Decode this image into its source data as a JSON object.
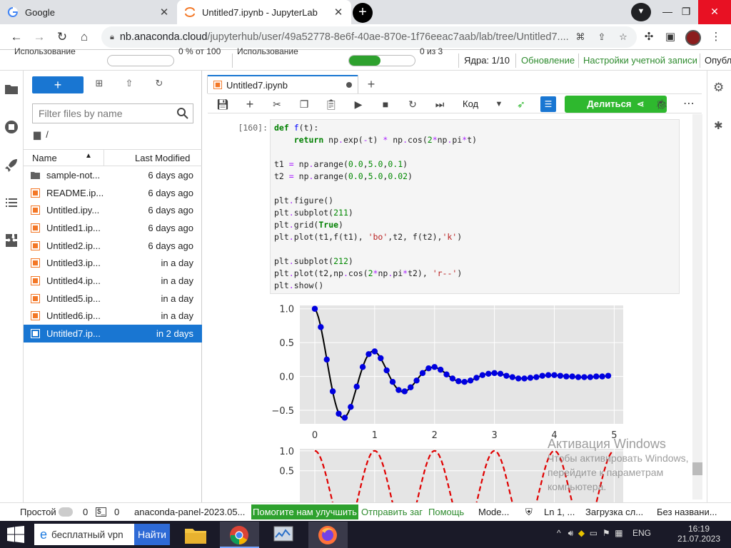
{
  "browser": {
    "tabs": [
      {
        "title": "Google",
        "active": false
      },
      {
        "title": "Untitled7.ipynb - JupyterLab",
        "active": true
      }
    ],
    "url_host": "nb.anaconda.cloud",
    "url_path": "/jupyterhub/user/49a52778-8e6f-40ae-870e-1f76eeac7aab/lab/tree/Untitled7...."
  },
  "jupyter_top": {
    "usage_label_1": "Использование",
    "usage_value_1": "0 % от 100",
    "usage_label_2": "Использование",
    "usage_value_2": "0 из 3",
    "cores": "Ядра: 1/10",
    "update": "Обновление",
    "account_settings": "Настройки учетной записи",
    "publish": "Опубл",
    "bar2_fill": 0.48
  },
  "filebrowser": {
    "new_label": "+",
    "filter_placeholder": "Filter files by name",
    "breadcrumb": "/",
    "col_name": "Name",
    "col_modified": "Last Modified",
    "files": [
      {
        "name": "sample-not...",
        "modified": "6 days ago",
        "type": "folder"
      },
      {
        "name": "README.ip...",
        "modified": "6 days ago",
        "type": "notebook"
      },
      {
        "name": "Untitled.ipy...",
        "modified": "6 days ago",
        "type": "notebook"
      },
      {
        "name": "Untitled1.ip...",
        "modified": "6 days ago",
        "type": "notebook"
      },
      {
        "name": "Untitled2.ip...",
        "modified": "6 days ago",
        "type": "notebook"
      },
      {
        "name": "Untitled3.ip...",
        "modified": "in a day",
        "type": "notebook"
      },
      {
        "name": "Untitled4.ip...",
        "modified": "in a day",
        "type": "notebook"
      },
      {
        "name": "Untitled5.ip...",
        "modified": "in a day",
        "type": "notebook"
      },
      {
        "name": "Untitled6.ip...",
        "modified": "in a day",
        "type": "notebook"
      },
      {
        "name": "Untitled7.ip...",
        "modified": "in 2 days",
        "type": "notebook",
        "selected": true
      }
    ]
  },
  "notebook": {
    "tab_title": "Untitled7.ipynb",
    "kernel_mode": "Код",
    "share_label": "Делиться",
    "prompt": "[160]:"
  },
  "chart_data": [
    {
      "type": "line",
      "x": [
        0.0,
        0.1,
        0.2,
        0.3,
        0.4,
        0.5,
        0.6,
        0.7,
        0.8,
        0.9,
        1.0,
        1.1,
        1.2,
        1.3,
        1.4,
        1.5,
        1.6,
        1.7,
        1.8,
        1.9,
        2.0,
        2.1,
        2.2,
        2.3,
        2.4,
        2.5,
        2.6,
        2.7,
        2.8,
        2.9,
        3.0,
        3.1,
        3.2,
        3.3,
        3.4,
        3.5,
        3.6,
        3.7,
        3.8,
        3.9,
        4.0,
        4.1,
        4.2,
        4.3,
        4.4,
        4.5,
        4.6,
        4.7,
        4.8,
        4.9
      ],
      "series": [
        {
          "values": [
            1.0,
            0.73,
            0.25,
            -0.22,
            -0.55,
            -0.61,
            -0.45,
            -0.15,
            0.14,
            0.33,
            0.37,
            0.27,
            0.09,
            -0.08,
            -0.2,
            -0.22,
            -0.16,
            -0.06,
            0.05,
            0.12,
            0.14,
            0.1,
            0.03,
            -0.03,
            -0.07,
            -0.08,
            -0.06,
            -0.02,
            0.02,
            0.04,
            0.05,
            0.04,
            0.01,
            -0.01,
            -0.03,
            -0.03,
            -0.02,
            -0.01,
            0.01,
            0.02,
            0.02,
            0.01,
            0.0,
            0.0,
            -0.01,
            -0.01,
            -0.01,
            0.0,
            0.0,
            0.01
          ]
        }
      ],
      "xlim": [
        -0.25,
        5.15
      ],
      "ylim": [
        -0.7,
        1.05
      ],
      "xticks": [
        "0",
        "1",
        "2",
        "3",
        "4",
        "5"
      ],
      "yticks": [
        "1.0",
        "0.5",
        "0.0",
        "−0.5"
      ],
      "grid": true
    },
    {
      "type": "line",
      "x_range": [
        0,
        4.98
      ],
      "series": [
        {
          "color": "#e00000",
          "style": "dashed"
        }
      ],
      "xlim": [
        -0.25,
        5.15
      ],
      "ylim": [
        -1.1,
        1.05
      ],
      "yticks": [
        "1.0",
        "0.5"
      ],
      "grid": true
    }
  ],
  "watermark": {
    "line1": "Активация Windows",
    "line2": "Чтобы активировать Windows,",
    "line3": "перейдите к параметрам",
    "line4": "компьютера."
  },
  "statusbar": {
    "mode": "Простой",
    "n1": "0",
    "n2": "0",
    "panel": "anaconda-panel-2023.05...",
    "help": "Помогите нам улучшить",
    "send": "Отправить заг",
    "help2": "Помощь",
    "mode2": "Mode...",
    "ln": "Ln 1, ...",
    "loading": "Загрузка сл...",
    "untitled": "Без названи..."
  },
  "taskbar": {
    "search_text": "бесплатный vpn",
    "find_label": "Найти",
    "lang": "ENG",
    "time": "16:19",
    "date": "21.07.2023"
  }
}
